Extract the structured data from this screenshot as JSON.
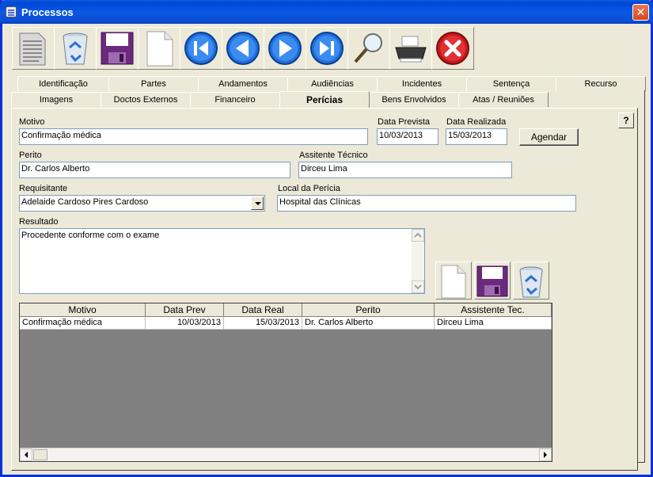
{
  "window": {
    "title": "Processos"
  },
  "toolbar": {
    "buttons": [
      {
        "name": "list-document",
        "icon": "document-lines-icon"
      },
      {
        "name": "delete",
        "icon": "recycle-bin-icon"
      },
      {
        "name": "save",
        "icon": "floppy-disk-icon"
      },
      {
        "name": "new",
        "icon": "blank-page-icon"
      },
      {
        "name": "first",
        "icon": "first-record-icon"
      },
      {
        "name": "previous",
        "icon": "previous-record-icon"
      },
      {
        "name": "next",
        "icon": "next-record-icon"
      },
      {
        "name": "last",
        "icon": "last-record-icon"
      },
      {
        "name": "search",
        "icon": "magnifier-icon"
      },
      {
        "name": "print",
        "icon": "printer-icon"
      },
      {
        "name": "close",
        "icon": "close-circle-icon"
      }
    ]
  },
  "tabs": {
    "row1": [
      "Identificação",
      "Partes",
      "Andamentos",
      "Audiências",
      "Incidentes",
      "Sentença",
      "Recurso"
    ],
    "row2": [
      "Imagens",
      "Doctos Externos",
      "Financeiro",
      "Perícias",
      "Bens Envolvidos",
      "Atas / Reuniões"
    ],
    "active": "Perícias"
  },
  "form": {
    "motivo_label": "Motivo",
    "motivo_value": "Confirmação médica",
    "data_prevista_label": "Data Prevista",
    "data_prevista_value": "10/03/2013",
    "data_realizada_label": "Data Realizada",
    "data_realizada_value": "15/03/2013",
    "agendar_label": "Agendar",
    "perito_label": "Perito",
    "perito_value": "Dr. Carlos Alberto",
    "assistente_label": "Assitente Técnico",
    "assistente_value": "Dirceu Lima",
    "requisitante_label": "Requisitante",
    "requisitante_value": "Adelaide Cardoso Pires Cardoso",
    "local_label": "Local da Perícia",
    "local_value": "Hospital das Clínicas",
    "resultado_label": "Resultado",
    "resultado_value": "Procedente conforme com o exame",
    "help_label": "?"
  },
  "grid": {
    "columns": [
      "Motivo",
      "Data Prev",
      "Data Real",
      "Perito",
      "Assistente Tec."
    ],
    "rows": [
      [
        "Confirmação médica",
        "10/03/2013",
        "15/03/2013",
        "Dr. Carlos Alberto",
        "Dirceu Lima"
      ]
    ]
  },
  "colors": {
    "titlebar": "#0a58e6",
    "face": "#ece9d8",
    "grid_empty": "#808080"
  }
}
